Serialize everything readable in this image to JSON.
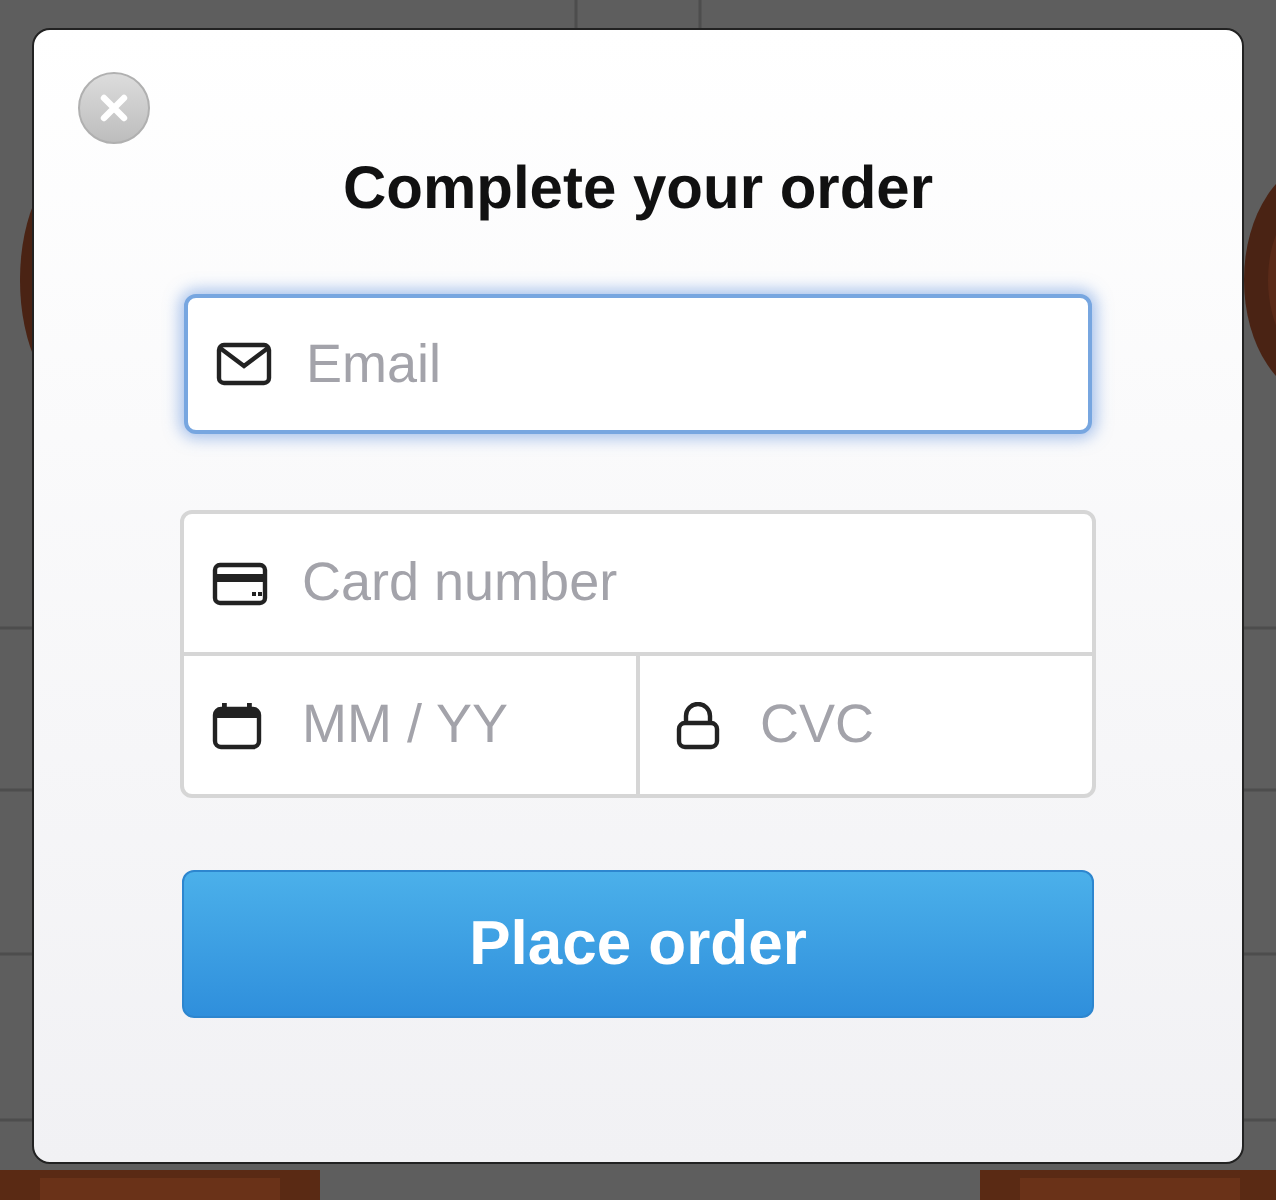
{
  "dialog": {
    "title": "Complete your order"
  },
  "email_field": {
    "placeholder": "Email",
    "focused": true
  },
  "card_fields": [
    {
      "kind": "card",
      "placeholder": "Card number",
      "focused": false
    },
    {
      "kind": "expiry",
      "placeholder": "MM / YY",
      "focused": false
    },
    {
      "kind": "cvc",
      "placeholder": "CVC",
      "focused": false
    }
  ],
  "submit_button": {
    "label": "Place order"
  }
}
